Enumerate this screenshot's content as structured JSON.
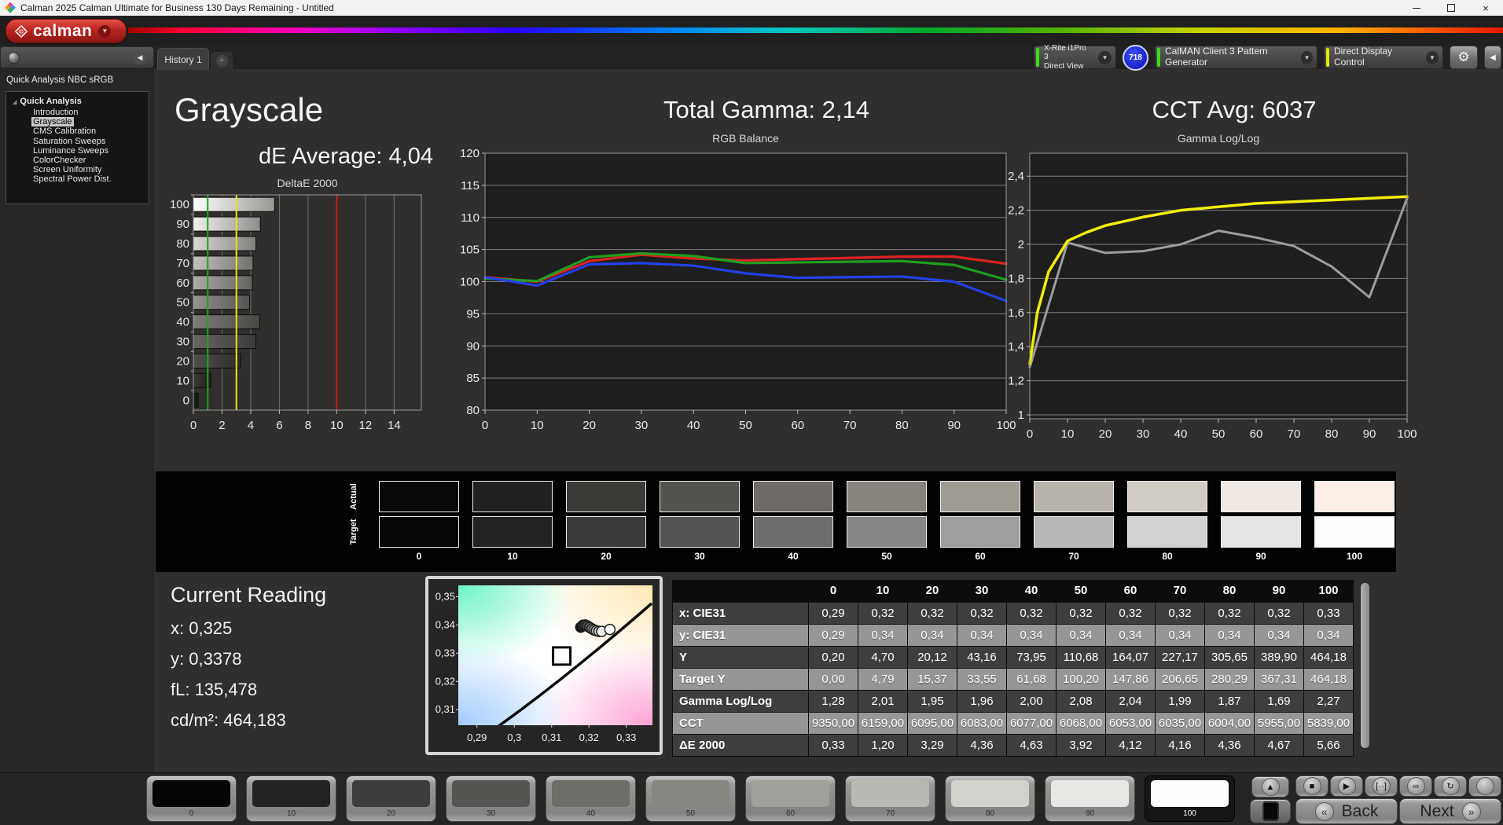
{
  "title_bar": {
    "title": "Calman 2025 Calman Ultimate for Business 130 Days Remaining  - Untitled",
    "close": "×"
  },
  "header": {
    "logo_text": "calman"
  },
  "tab_row": {
    "tab": "History 1",
    "add_tab": "+"
  },
  "meter_dropdown": {
    "line1": "X-Rite i1Pro 3",
    "line2": "Direct View",
    "accent": "#3fdc1a",
    "badge": "718"
  },
  "pattern_dropdown": {
    "label": "CalMAN Client 3 Pattern Generator",
    "accent": "#3fdc1a"
  },
  "display_dropdown": {
    "label": "Direct Display Control",
    "accent": "#dfe70d"
  },
  "icons": {
    "gear": "⚙",
    "collapse_left": "◀",
    "dropdown": "▼",
    "tree_expanded": "◢"
  },
  "sidebar": {
    "header": "Quick Analysis NBC sRGB",
    "root": "Quick Analysis",
    "items": [
      {
        "label": "Introduction",
        "selected": false
      },
      {
        "label": "Grayscale",
        "selected": true
      },
      {
        "label": "CMS Calibration",
        "selected": false
      },
      {
        "label": "Saturation Sweeps",
        "selected": false
      },
      {
        "label": "Luminance Sweeps",
        "selected": false
      },
      {
        "label": "ColorChecker",
        "selected": false
      },
      {
        "label": "Screen Uniformity",
        "selected": false
      },
      {
        "label": "Spectral Power Dist.",
        "selected": false
      }
    ]
  },
  "grayscale_panel": {
    "heading": "Grayscale",
    "subheading": "dE Average: 4,04",
    "chart_data": {
      "type": "bar",
      "orientation": "horizontal",
      "title": "DeltaE 2000",
      "categories": [
        "100",
        "90",
        "80",
        "70",
        "60",
        "50",
        "40",
        "30",
        "20",
        "10",
        "0"
      ],
      "values": [
        5.66,
        4.67,
        4.36,
        4.16,
        4.12,
        3.92,
        4.63,
        4.36,
        3.29,
        1.2,
        0.33
      ],
      "xlim": [
        0,
        15.9
      ],
      "xticks": [
        0,
        2,
        4,
        6,
        8,
        10,
        12,
        14
      ],
      "reference_lines": [
        {
          "value": 1,
          "color": "#1ca426"
        },
        {
          "value": 3,
          "color": "#e6e60c"
        },
        {
          "value": 10,
          "color": "#cf1d1d"
        }
      ],
      "bar_colors": [
        [
          "#ffffff",
          "#999793"
        ],
        [
          "#f1f0ee",
          "#8f8d89"
        ],
        [
          "#dbd9d6",
          "#817f7b"
        ],
        [
          "#c4c2be",
          "#72706c"
        ],
        [
          "#adaba7",
          "#64625f"
        ],
        [
          "#969490",
          "#565451"
        ],
        [
          "#7f7d79",
          "#484744"
        ],
        [
          "#686663",
          "#3b3a38"
        ],
        [
          "#51504d",
          "#2e2d2c"
        ],
        [
          "#3a3937",
          "#222120"
        ],
        [
          "#232221",
          "#151514"
        ]
      ]
    }
  },
  "gamma_panel": {
    "heading": "Total Gamma: 2,14",
    "chart_data": {
      "type": "line",
      "title": "RGB Balance",
      "x": [
        0,
        10,
        20,
        30,
        40,
        50,
        60,
        70,
        80,
        90,
        100
      ],
      "ylim": [
        80,
        120
      ],
      "yticks": [
        80,
        85,
        90,
        95,
        100,
        105,
        110,
        115,
        120
      ],
      "xticks": [
        0,
        10,
        20,
        30,
        40,
        50,
        60,
        70,
        80,
        90,
        100
      ],
      "series": [
        {
          "name": "Red",
          "color": "#dd2222",
          "values": [
            100.7,
            100.0,
            103.2,
            104.2,
            103.6,
            103.3,
            103.5,
            103.7,
            103.9,
            103.9,
            102.8
          ]
        },
        {
          "name": "Green",
          "color": "#1f9e1f",
          "values": [
            100.5,
            100.1,
            103.8,
            104.4,
            104.0,
            102.9,
            103.0,
            103.1,
            103.2,
            102.6,
            100.3
          ]
        },
        {
          "name": "Blue",
          "color": "#2440e8",
          "values": [
            100.7,
            99.4,
            102.7,
            102.9,
            102.5,
            101.3,
            100.6,
            100.7,
            100.8,
            100.0,
            97.0
          ]
        }
      ]
    }
  },
  "cct_panel": {
    "heading": "CCT Avg: 6037",
    "chart_data": {
      "type": "line",
      "title": "Gamma Log/Log",
      "ylim": [
        1,
        2.56
      ],
      "yticks": [
        1,
        1.2,
        1.4,
        1.6,
        1.8,
        2,
        2.2,
        2.4
      ],
      "ytick_labels": [
        "1",
        "1,2",
        "1,4",
        "1,6",
        "1,8",
        "2",
        "2,2",
        "2,4"
      ],
      "xticks": [
        0,
        10,
        20,
        30,
        40,
        50,
        60,
        70,
        80,
        90,
        100
      ],
      "series": [
        {
          "name": "Target",
          "color": "#f2ee08",
          "x": [
            0,
            2,
            5,
            10,
            15,
            20,
            30,
            40,
            50,
            60,
            70,
            80,
            90,
            100
          ],
          "values": [
            1.3,
            1.6,
            1.84,
            2.02,
            2.07,
            2.11,
            2.16,
            2.2,
            2.22,
            2.24,
            2.25,
            2.26,
            2.27,
            2.28
          ]
        },
        {
          "name": "Measured",
          "color": "#9c9c9c",
          "x": [
            0,
            10,
            20,
            30,
            40,
            50,
            60,
            70,
            80,
            90,
            100
          ],
          "values": [
            1.28,
            2.01,
            1.95,
            1.96,
            2.0,
            2.08,
            2.04,
            1.99,
            1.87,
            1.69,
            2.27
          ]
        }
      ]
    }
  },
  "strip": {
    "row_labels": [
      "Actual",
      "Target"
    ],
    "labels": [
      "0",
      "10",
      "20",
      "30",
      "40",
      "50",
      "60",
      "70",
      "80",
      "90",
      "100"
    ],
    "actual_colors": [
      "#080808",
      "#232120",
      "#3c3a37",
      "#555350",
      "#6e6b66",
      "#87847d",
      "#a09c94",
      "#b8b4ab",
      "#d0ccc3",
      "#f0e8e2",
      "#fbeee6"
    ],
    "target_colors": [
      "#060606",
      "#222222",
      "#3b3b3b",
      "#545454",
      "#6d6d6d",
      "#868686",
      "#9f9f9f",
      "#b8b8b8",
      "#d1d1d1",
      "#e5e5e5",
      "#fdfdfd"
    ]
  },
  "current_reading": {
    "title": "Current Reading",
    "lines": [
      "x: 0,325",
      "y: 0,3378",
      "fL: 135,478",
      "cd/m²: 464,183"
    ]
  },
  "cie_chart": {
    "chart_data": {
      "type": "scatter",
      "xlim": [
        0.285,
        0.337
      ],
      "ylim": [
        0.3045,
        0.354
      ],
      "xticks": [
        0.29,
        0.3,
        0.31,
        0.32,
        0.33
      ],
      "xtick_labels": [
        "0,29",
        "0,3",
        "0,31",
        "0,32",
        "0,33"
      ],
      "yticks": [
        0.31,
        0.32,
        0.33,
        0.34,
        0.35
      ],
      "ytick_labels": [
        "0,31",
        "0,32",
        "0,33",
        "0,34",
        "0,35"
      ],
      "target": {
        "x": 0.3127,
        "y": 0.329
      },
      "points": [
        {
          "x": 0.3178,
          "y": 0.3392,
          "fill": "#141414"
        },
        {
          "x": 0.3184,
          "y": 0.3399,
          "fill": "#262626"
        },
        {
          "x": 0.319,
          "y": 0.34,
          "fill": "#3a3a3a"
        },
        {
          "x": 0.3196,
          "y": 0.3396,
          "fill": "#505050"
        },
        {
          "x": 0.3202,
          "y": 0.3391,
          "fill": "#686868"
        },
        {
          "x": 0.3208,
          "y": 0.3386,
          "fill": "#828282"
        },
        {
          "x": 0.3214,
          "y": 0.3382,
          "fill": "#9c9c9c"
        },
        {
          "x": 0.322,
          "y": 0.3379,
          "fill": "#b8b8b8"
        },
        {
          "x": 0.3227,
          "y": 0.3377,
          "fill": "#d8d8d8"
        },
        {
          "x": 0.3234,
          "y": 0.3377,
          "fill": "#efefef"
        },
        {
          "x": 0.3256,
          "y": 0.3384,
          "fill": "#ffffff"
        }
      ]
    }
  },
  "table": {
    "columns": [
      "",
      "0",
      "10",
      "20",
      "30",
      "40",
      "50",
      "60",
      "70",
      "80",
      "90",
      "100"
    ],
    "rows": [
      {
        "label": "x: CIE31",
        "shade": "dark",
        "values": [
          "0,29",
          "0,32",
          "0,32",
          "0,32",
          "0,32",
          "0,32",
          "0,32",
          "0,32",
          "0,32",
          "0,32",
          "0,33"
        ]
      },
      {
        "label": "y: CIE31",
        "shade": "light",
        "values": [
          "0,29",
          "0,34",
          "0,34",
          "0,34",
          "0,34",
          "0,34",
          "0,34",
          "0,34",
          "0,34",
          "0,34",
          "0,34"
        ]
      },
      {
        "label": "Y",
        "shade": "dark",
        "values": [
          "0,20",
          "4,70",
          "20,12",
          "43,16",
          "73,95",
          "110,68",
          "164,07",
          "227,17",
          "305,65",
          "389,90",
          "464,18"
        ]
      },
      {
        "label": "Target Y",
        "shade": "light",
        "values": [
          "0,00",
          "4,79",
          "15,37",
          "33,55",
          "61,68",
          "100,20",
          "147,86",
          "206,65",
          "280,29",
          "367,31",
          "464,18"
        ]
      },
      {
        "label": "Gamma Log/Log",
        "shade": "dark",
        "values": [
          "1,28",
          "2,01",
          "1,95",
          "1,96",
          "2,00",
          "2,08",
          "2,04",
          "1,99",
          "1,87",
          "1,69",
          "2,27"
        ]
      },
      {
        "label": "CCT",
        "shade": "light",
        "values": [
          "9350,00",
          "6159,00",
          "6095,00",
          "6083,00",
          "6077,00",
          "6068,00",
          "6053,00",
          "6035,00",
          "6004,00",
          "5955,00",
          "5839,00"
        ]
      },
      {
        "label": "ΔE 2000",
        "shade": "dark",
        "values": [
          "0,33",
          "1,20",
          "3,29",
          "4,36",
          "4,63",
          "3,92",
          "4,12",
          "4,16",
          "4,36",
          "4,67",
          "5,66"
        ]
      }
    ]
  },
  "toolbar": {
    "swatches": [
      {
        "label": "0",
        "color": "#050505",
        "selected": false
      },
      {
        "label": "10",
        "color": "#242322",
        "selected": false
      },
      {
        "label": "20",
        "color": "#3e3d3b",
        "selected": false
      },
      {
        "label": "30",
        "color": "#575551",
        "selected": false
      },
      {
        "label": "40",
        "color": "#6f6d68",
        "selected": false
      },
      {
        "label": "50",
        "color": "#888681",
        "selected": false
      },
      {
        "label": "60",
        "color": "#a19f9a",
        "selected": false
      },
      {
        "label": "70",
        "color": "#bab8b3",
        "selected": false
      },
      {
        "label": "80",
        "color": "#d3d1cc",
        "selected": false
      },
      {
        "label": "90",
        "color": "#e9e7e3",
        "selected": false
      },
      {
        "label": "100",
        "color": "#fdfdfd",
        "selected": true
      }
    ],
    "pager_up": "▲",
    "transport_buttons": [
      {
        "name": "stop",
        "glyph": "■"
      },
      {
        "name": "play",
        "glyph": "▶"
      },
      {
        "name": "marker",
        "glyph": "[··]"
      },
      {
        "name": "continuous",
        "glyph": "∞"
      },
      {
        "name": "refresh",
        "glyph": "↻"
      },
      {
        "name": "blank",
        "glyph": ""
      }
    ],
    "back_label": "Back",
    "next_label": "Next",
    "back_icon": "«",
    "next_icon": "»"
  }
}
